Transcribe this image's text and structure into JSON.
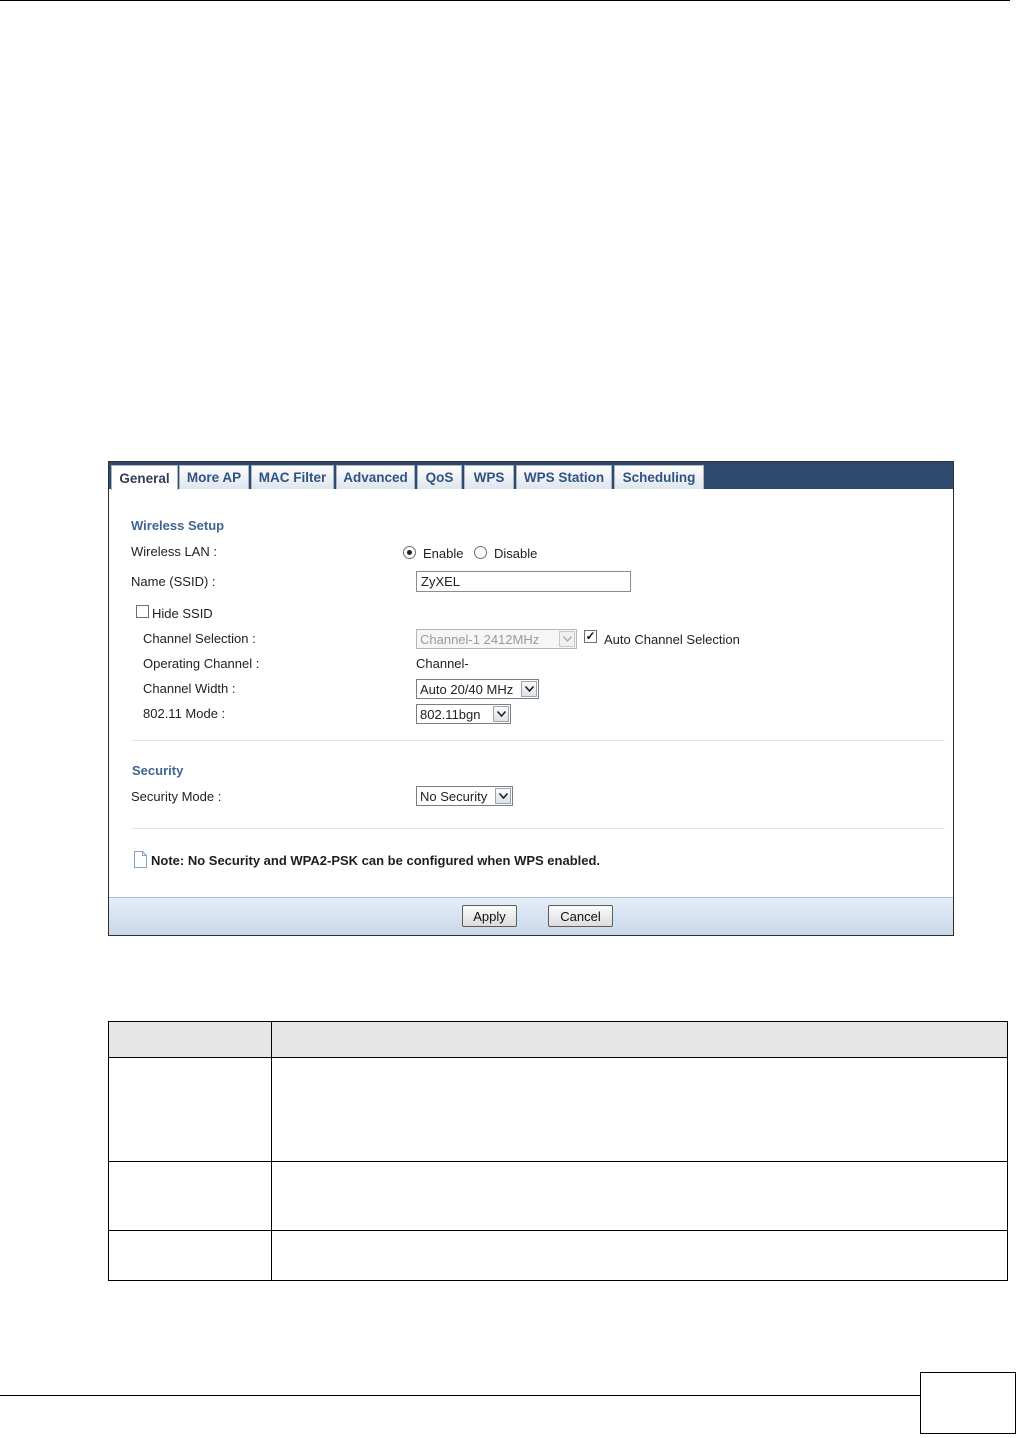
{
  "tabs": [
    "General",
    "More AP",
    "MAC Filter",
    "Advanced",
    "QoS",
    "WPS",
    "WPS Station",
    "Scheduling"
  ],
  "active_tab": "General",
  "wireless_setup": {
    "title": "Wireless Setup",
    "wireless_lan_label": "Wireless LAN :",
    "enable_label": "Enable",
    "disable_label": "Disable",
    "wireless_lan_value": "Enable",
    "ssid_label": "Name (SSID) :",
    "ssid_value": "ZyXEL",
    "hide_ssid_label": "Hide SSID",
    "hide_ssid_checked": false,
    "channel_selection_label": "Channel Selection :",
    "channel_selection_value": "Channel-1 2412MHz",
    "auto_channel_label": "Auto Channel Selection",
    "auto_channel_checked": true,
    "operating_channel_label": "Operating Channel :",
    "operating_channel_value": "Channel-",
    "channel_width_label": "Channel Width :",
    "channel_width_value": "Auto 20/40 MHz",
    "mode_label": "802.11 Mode :",
    "mode_value": "802.11bgn"
  },
  "security": {
    "title": "Security",
    "mode_label": "Security Mode :",
    "mode_value": "No Security"
  },
  "note": "Note: No Security and WPA2-PSK can be configured when WPS enabled.",
  "buttons": {
    "apply": "Apply",
    "cancel": "Cancel"
  },
  "colors": {
    "tab_bar": "#2e4a6c",
    "tab_text": "#2f5482",
    "section_title": "#3f6592",
    "footer_bar": "#c9d8ea"
  }
}
